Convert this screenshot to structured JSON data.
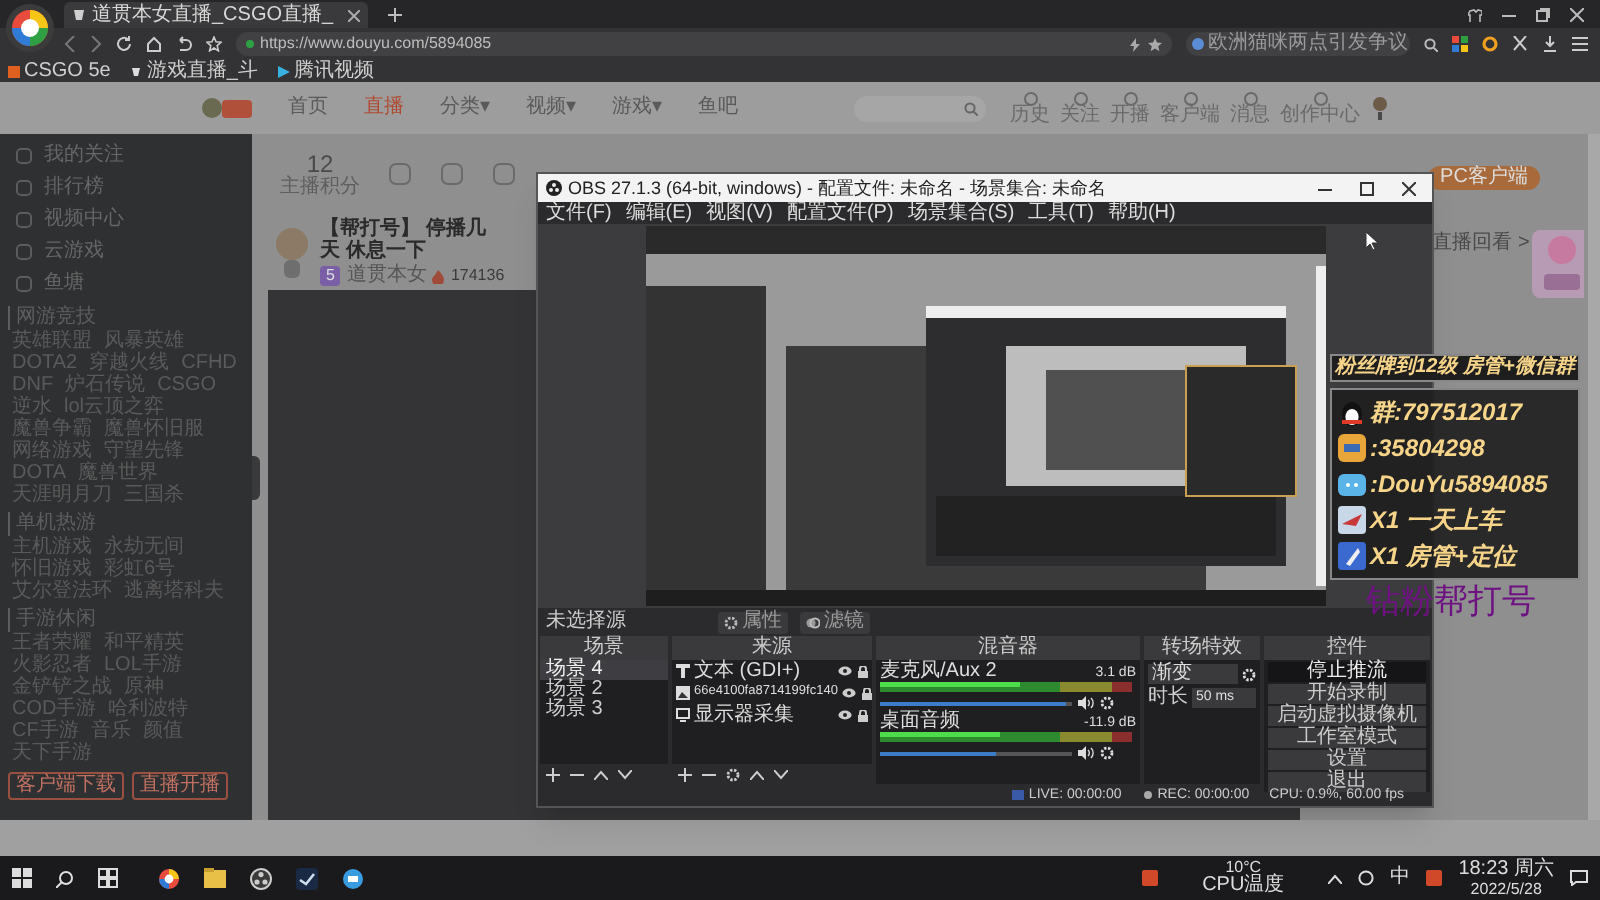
{
  "browser": {
    "tab_title": "道贯本女直播_CSGO直播_",
    "url": "https://www.douyu.com/5894085",
    "search_hint": "欧洲猫咪两点引发争议",
    "bookmarks": [
      "CSGO 5e",
      "游戏直播_斗",
      "腾讯视频"
    ]
  },
  "site": {
    "nav": [
      {
        "label": "首页",
        "selected": false
      },
      {
        "label": "直播",
        "selected": true
      },
      {
        "label": "分类▾",
        "selected": false
      },
      {
        "label": "视频▾",
        "selected": false
      },
      {
        "label": "游戏▾",
        "selected": false
      },
      {
        "label": "鱼吧",
        "selected": false
      }
    ],
    "header_icons": [
      "历史",
      "关注",
      "开播",
      "客户端",
      "消息",
      "创作中心"
    ],
    "sidebar": {
      "items": [
        "我的关注",
        "排行榜",
        "视频中心",
        "云游戏",
        "鱼塘"
      ],
      "sections": [
        {
          "title": "网游竞技",
          "items": [
            "英雄联盟",
            "风暴英雄",
            "DOTA2",
            "穿越火线",
            "CFHD",
            "DNF",
            "炉石传说",
            "CSGO",
            "逆水",
            "lol云顶之弈",
            "魔兽争霸",
            "魔兽怀旧服",
            "网络游戏",
            "守望先锋",
            "DOTA",
            "魔兽世界",
            "天涯明月刀",
            "三国杀"
          ]
        },
        {
          "title": "单机热游",
          "items": [
            "主机游戏",
            "永劫无间",
            "怀旧游戏",
            "彩虹6号",
            "艾尔登法环",
            "逃离塔科夫"
          ]
        },
        {
          "title": "手游休闲",
          "items": [
            "王者荣耀",
            "和平精英",
            "火影忍者",
            "LOL手游",
            "金铲铲之战",
            "原神",
            "COD手游",
            "哈利波特",
            "CF手游",
            "音乐",
            "颜值",
            "天下手游"
          ]
        }
      ],
      "buttons": [
        "客户端下载",
        "直播开播"
      ]
    },
    "stream": {
      "score": "12",
      "score_label": "主播积分",
      "title": "【帮打号】 停播几天 休息一下",
      "level": "5",
      "streamer": "道贯本女",
      "popularity": "174136"
    },
    "right_panel": {
      "client_button": "PC客户端",
      "replay_link": "直播回看 >"
    }
  },
  "overlay": {
    "header": "粉丝牌到12级 房管+微信群",
    "rows": [
      {
        "kind": "qq",
        "text": "群:797512017"
      },
      {
        "kind": "cat",
        "text": ":35804298"
      },
      {
        "kind": "tv",
        "text": ":DouYu5894085"
      },
      {
        "kind": "plane",
        "text": "X1 一天上车"
      },
      {
        "kind": "rocket",
        "text": "X1 房管+定位"
      }
    ],
    "caption": "钻粉帮打号"
  },
  "obs": {
    "title": "OBS 27.1.3 (64-bit, windows) - 配置文件: 未命名 - 场景集合: 未命名",
    "menu": [
      "文件(F)",
      "编辑(E)",
      "视图(V)",
      "配置文件(P)",
      "场景集合(S)",
      "工具(T)",
      "帮助(H)"
    ],
    "source_bar": {
      "label": "未选择源",
      "buttons": [
        "属性",
        "滤镜"
      ]
    },
    "dock_titles": [
      "场景",
      "来源",
      "混音器",
      "转场特效",
      "控件"
    ],
    "scenes": [
      {
        "name": "场景 4",
        "selected": true
      },
      {
        "name": "场景 2",
        "selected": false
      },
      {
        "name": "场景 3",
        "selected": false
      }
    ],
    "sources": [
      {
        "kind": "text",
        "name": "文本 (GDI+)"
      },
      {
        "kind": "image",
        "name": "66e4100fa8714199fc140"
      },
      {
        "kind": "display",
        "name": "显示器采集"
      }
    ],
    "mixer": [
      {
        "name": "麦克风/Aux 2",
        "reading": "3.1 dB",
        "level": 0.97
      },
      {
        "name": "桌面音频",
        "reading": "-11.9 dB",
        "level": 0.6
      }
    ],
    "transition": {
      "value": "渐变",
      "duration_label": "时长",
      "duration": "50 ms"
    },
    "controls": [
      {
        "label": "停止推流",
        "selected": true
      },
      {
        "label": "开始录制",
        "selected": false
      },
      {
        "label": "启动虚拟摄像机",
        "selected": false
      },
      {
        "label": "工作室模式",
        "selected": false
      },
      {
        "label": "设置",
        "selected": false
      },
      {
        "label": "退出",
        "selected": false
      }
    ],
    "status": [
      "LIVE: 00:00:00",
      "REC: 00:00:00",
      "CPU: 0.9%, 60.00 fps"
    ]
  },
  "taskbar": {
    "temperature": "10°C",
    "temperature_label": "CPU温度",
    "ime": "中",
    "time": "18:23 周六",
    "date": "2022/5/28"
  }
}
